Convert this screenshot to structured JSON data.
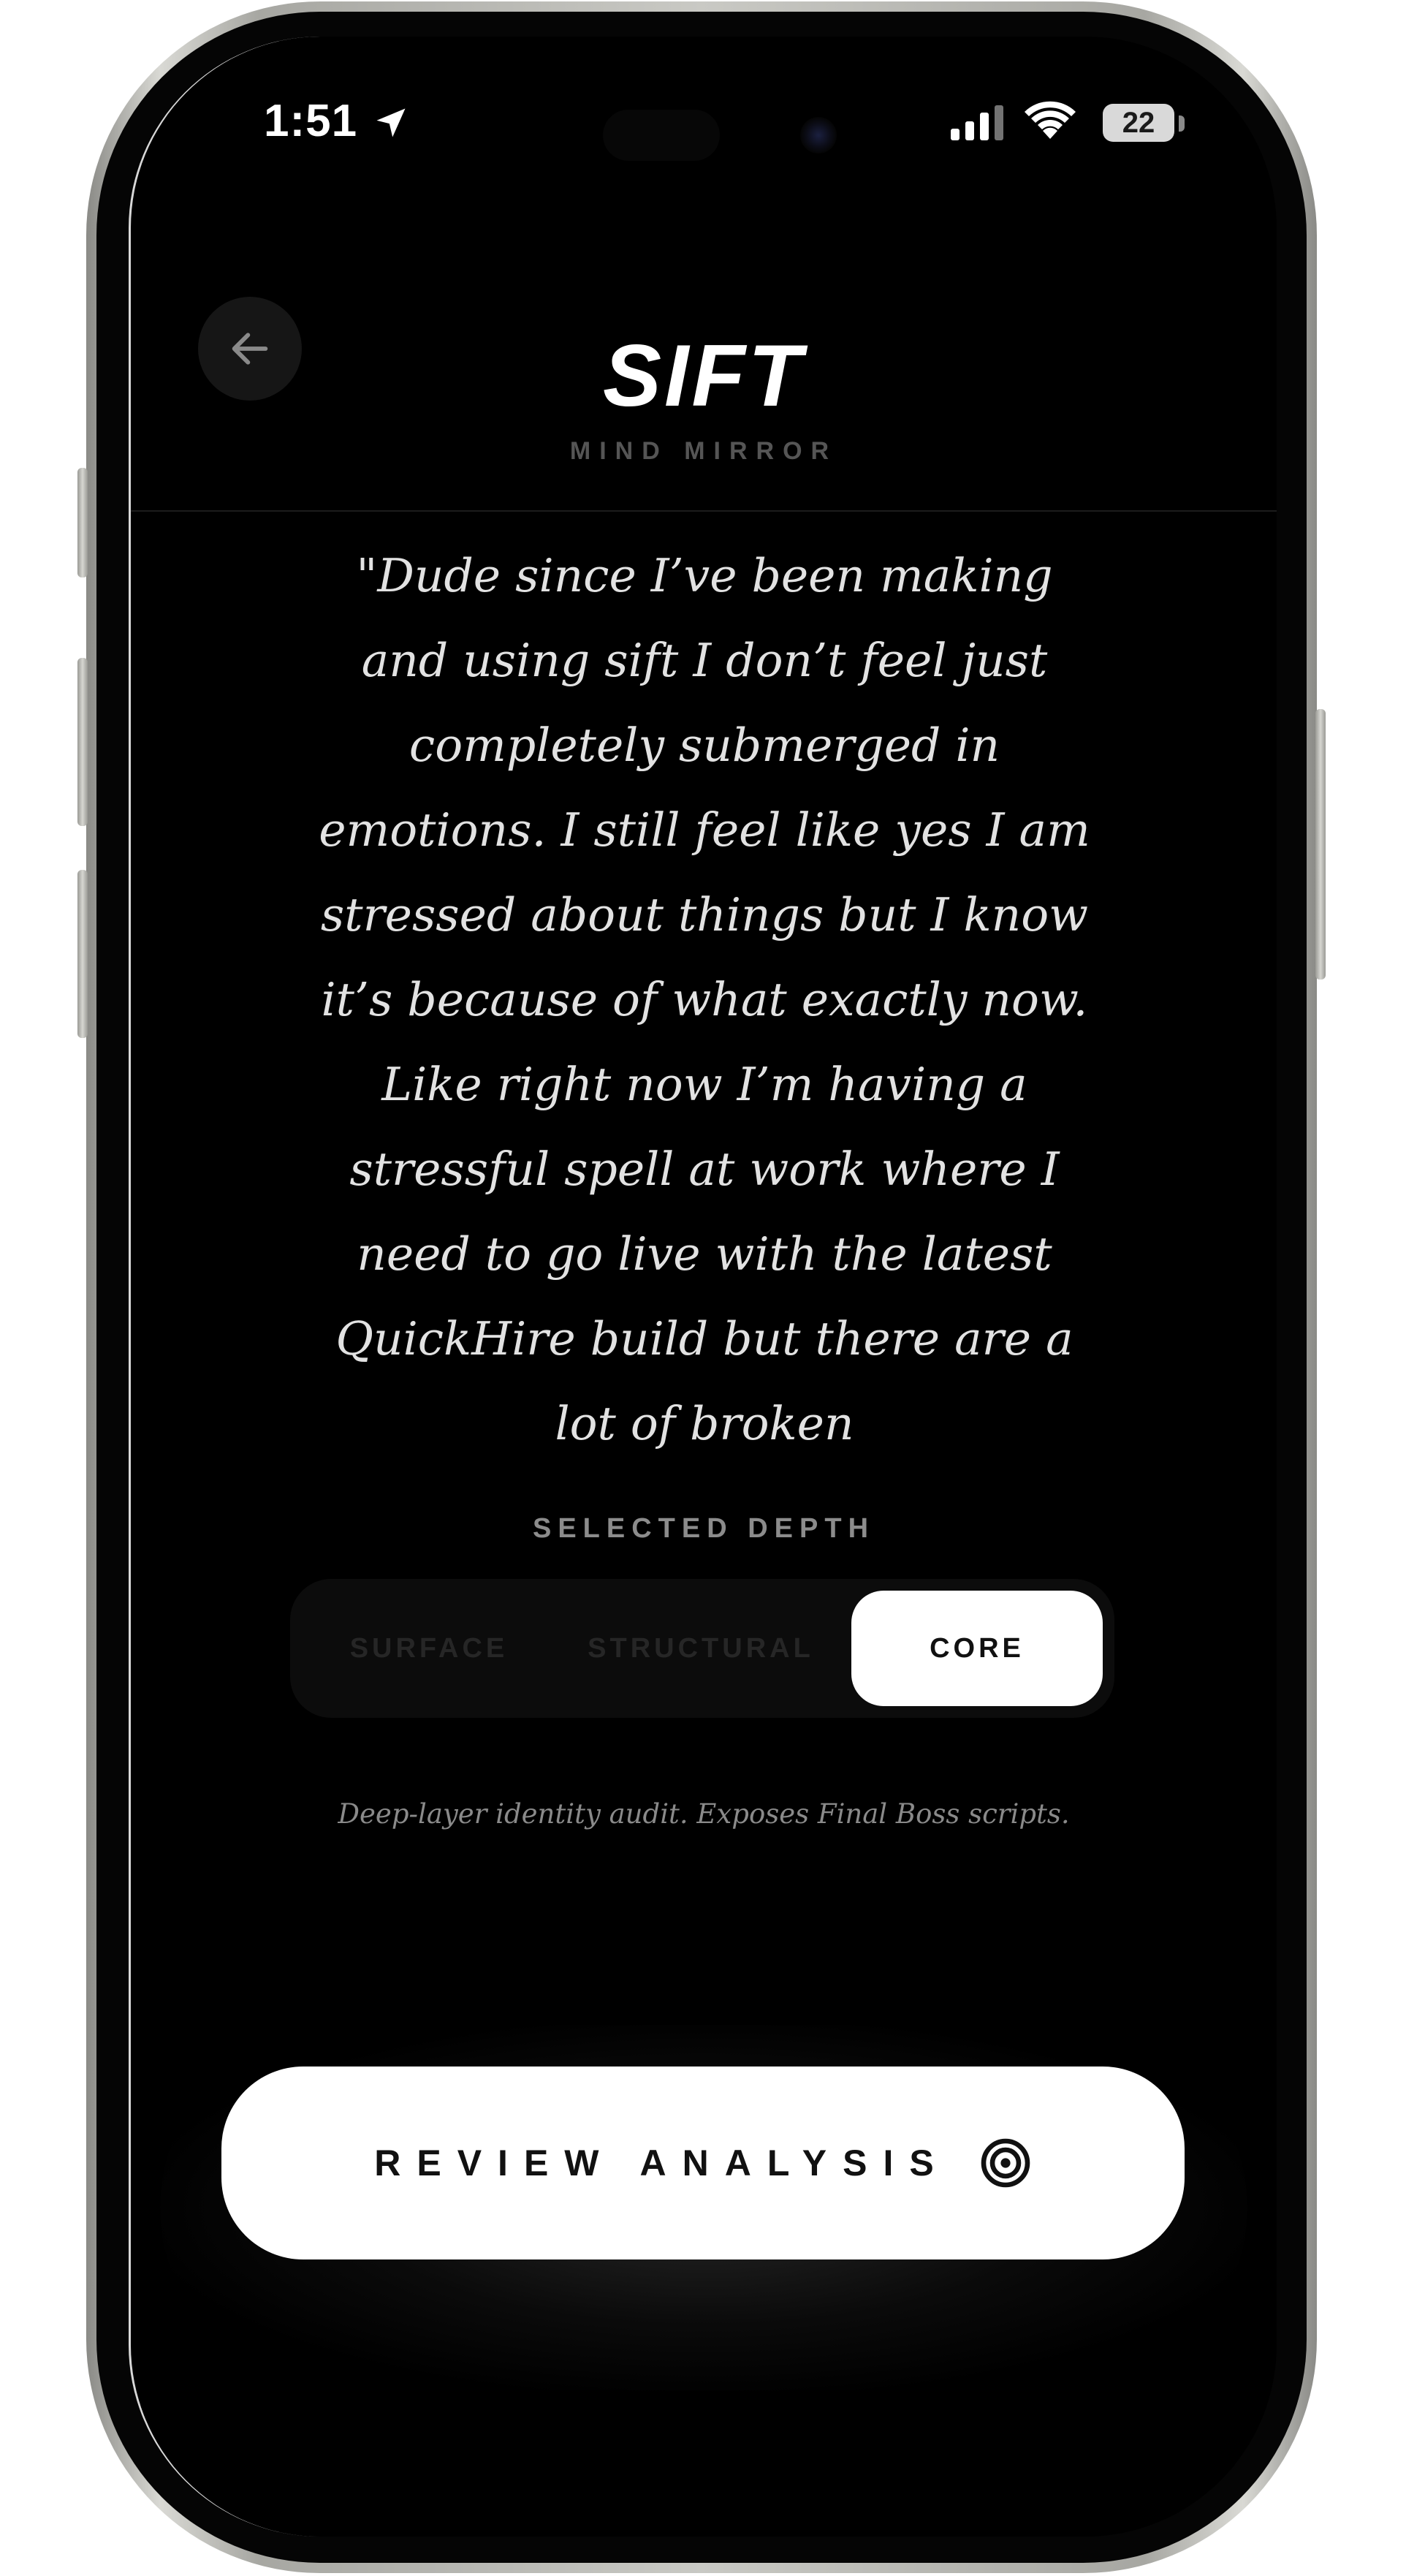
{
  "status_bar": {
    "time": "1:51",
    "battery_level": "22",
    "icons": [
      "location-arrow-icon",
      "cellular-signal-icon",
      "wifi-icon",
      "battery-icon"
    ]
  },
  "header": {
    "back_icon": "arrow-left-icon",
    "title": "SIFT",
    "subtitle": "MIND MIRROR"
  },
  "entry": {
    "text": "\"Dude since I’ve been making and using sift I don’t feel just completely submerged in emotions. I still feel like yes I am stressed about things but I know it’s because of what exactly now. Like right now I’m having a stressful spell at work where I need to go live with the latest QuickHire build but there are a lot of broken"
  },
  "depth": {
    "label": "SELECTED DEPTH",
    "options": [
      {
        "label": "SURFACE",
        "selected": false
      },
      {
        "label": "STRUCTURAL",
        "selected": false
      },
      {
        "label": "CORE",
        "selected": true
      }
    ],
    "description": "Deep-layer identity audit. Exposes Final Boss scripts."
  },
  "action": {
    "review_label": "REVIEW ANALYSIS",
    "review_icon": "target-icon"
  },
  "colors": {
    "background": "#000000",
    "accent": "#ffffff",
    "muted_text": "#8c8c8c"
  }
}
